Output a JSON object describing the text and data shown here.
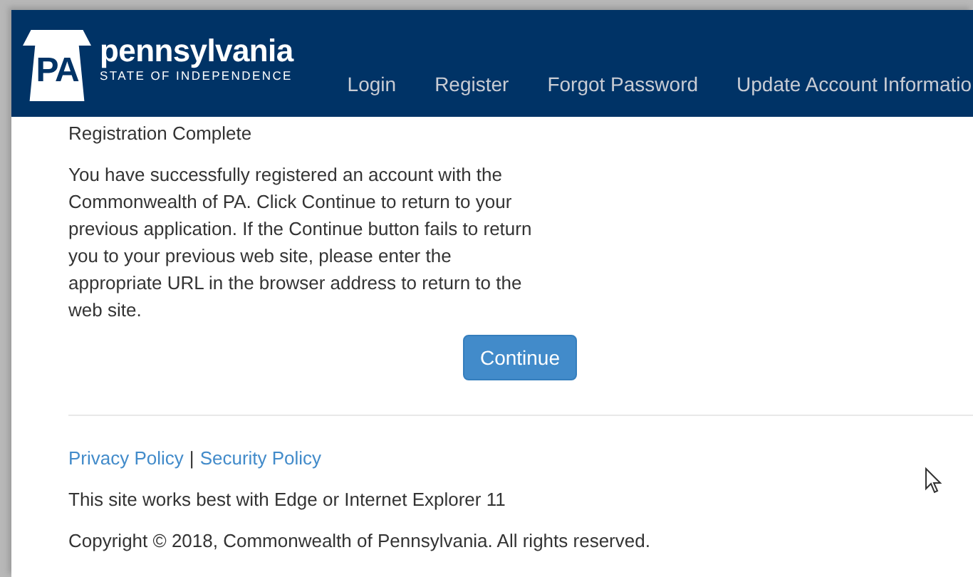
{
  "header": {
    "logo_initials": "PA",
    "logo_name": "pennsylvania",
    "logo_tagline": "STATE OF INDEPENDENCE",
    "nav": [
      {
        "label": "Login"
      },
      {
        "label": "Register"
      },
      {
        "label": "Forgot Password"
      },
      {
        "label": "Update Account Informatio"
      }
    ]
  },
  "content": {
    "heading": "Registration Complete",
    "message": "You have successfully registered an account with the Commonwealth of PA. Click Continue to return to your previous application. If the Continue button fails to return you to your previous web site, please enter the appropriate URL in the browser address to return to the web site.",
    "button": "Continue"
  },
  "footer": {
    "links": [
      "Privacy Policy",
      "Security Policy"
    ],
    "separator": "|",
    "note": "This site works best with Edge or Internet Explorer 11",
    "copyright": "Copyright © 2018, Commonwealth of Pennsylvania. All rights reserved."
  }
}
